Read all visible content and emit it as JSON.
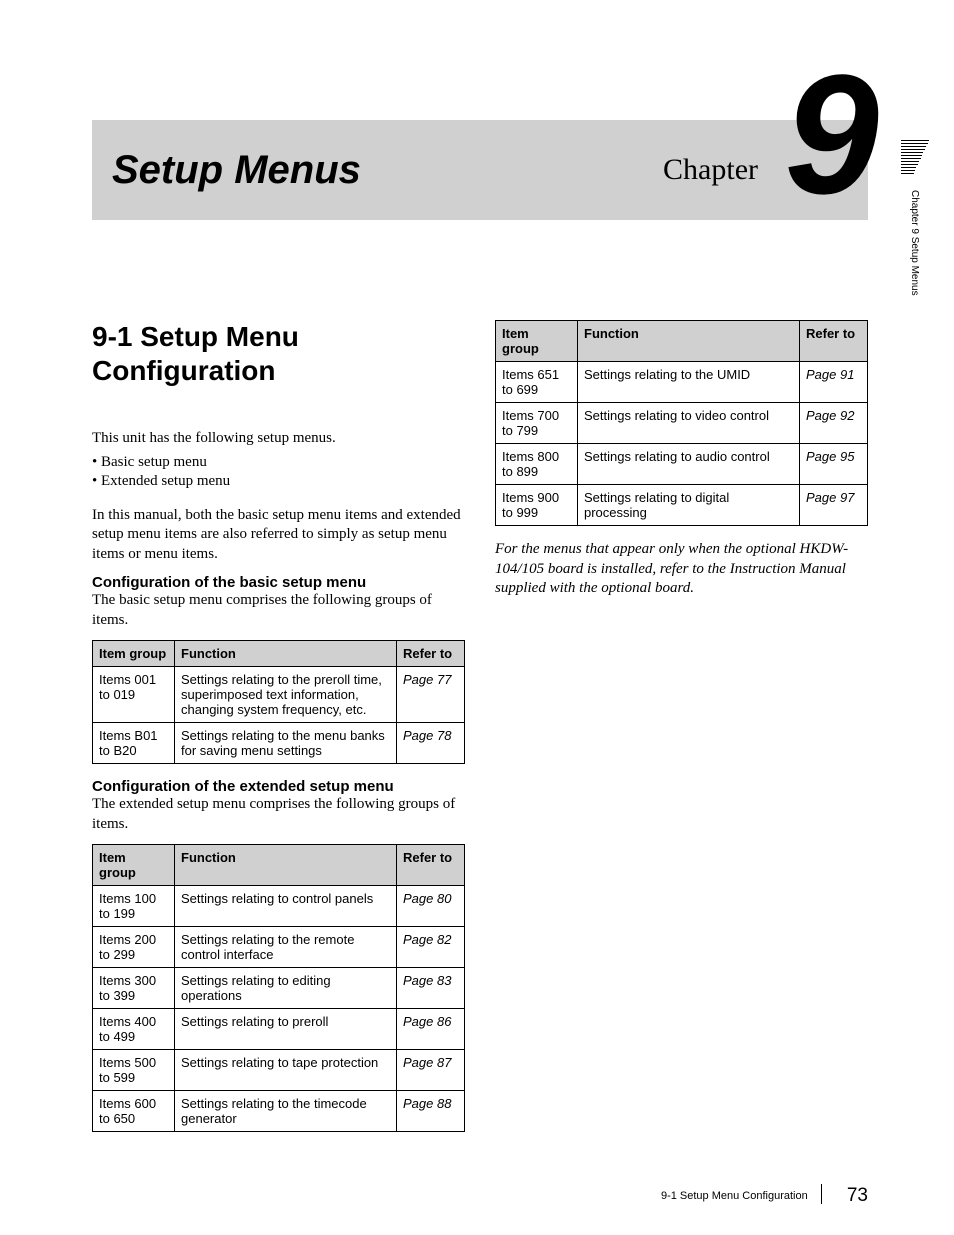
{
  "banner": {
    "title": "Setup Menus",
    "chapter_word": "Chapter",
    "chapter_number": "9"
  },
  "side_tab": "Chapter 9  Setup Menus",
  "section": {
    "heading": "9-1  Setup Menu Configuration",
    "intro": "This unit has the following setup menus.",
    "bullets": [
      "Basic setup menu",
      "Extended setup menu"
    ],
    "para2": "In this manual, both the basic setup menu items and extended setup menu items are also referred to simply as setup menu items or menu items.",
    "basic_head": "Configuration of the basic setup menu",
    "basic_desc": "The basic setup menu comprises the following groups of items.",
    "ext_head": "Configuration of the extended setup menu",
    "ext_desc": "The extended setup menu comprises the following groups of items."
  },
  "table_headers": {
    "c1": "Item group",
    "c1_wrap": "Item\ngroup",
    "c2": "Function",
    "c3": "Refer to"
  },
  "basic_table": [
    {
      "group": "Items 001 to 019",
      "func": "Settings relating to the preroll time, superimposed text information, changing system frequency, etc.",
      "ref": "Page 77"
    },
    {
      "group": "Items B01 to B20",
      "func": "Settings relating to the menu banks for saving menu settings",
      "ref": "Page 78"
    }
  ],
  "ext_table_left": [
    {
      "group": "Items 100 to 199",
      "func": "Settings relating to control panels",
      "ref": "Page 80"
    },
    {
      "group": "Items 200 to 299",
      "func": "Settings relating to the remote control interface",
      "ref": "Page 82"
    },
    {
      "group": "Items 300 to 399",
      "func": "Settings relating to editing operations",
      "ref": "Page 83"
    },
    {
      "group": "Items 400 to 499",
      "func": "Settings relating to preroll",
      "ref": "Page 86"
    },
    {
      "group": "Items 500 to 599",
      "func": "Settings relating to tape protection",
      "ref": "Page 87"
    },
    {
      "group": "Items 600 to 650",
      "func": "Settings relating to the timecode generator",
      "ref": "Page 88"
    }
  ],
  "ext_table_right": [
    {
      "group": "Items 651 to 699",
      "func": "Settings relating to the UMID",
      "ref": "Page 91"
    },
    {
      "group": "Items 700 to 799",
      "func": "Settings relating to video control",
      "ref": "Page 92"
    },
    {
      "group": "Items 800 to 899",
      "func": "Settings relating to audio control",
      "ref": "Page 95"
    },
    {
      "group": "Items 900 to 999",
      "func": "Settings relating to digital processing",
      "ref": "Page 97"
    }
  ],
  "note": "For the menus that appear only when the optional HKDW-104/105 board is installed, refer to the Instruction Manual supplied with the optional board.",
  "footer": {
    "section": "9-1  Setup Menu Configuration",
    "page": "73"
  }
}
